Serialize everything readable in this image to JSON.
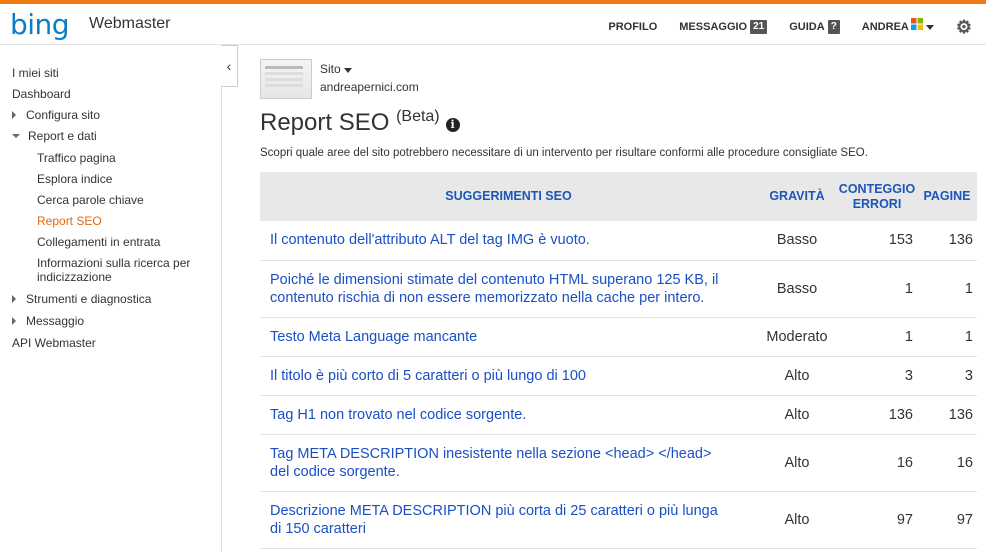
{
  "header": {
    "logo_text": "bing",
    "product": "Webmaster",
    "nav": {
      "profilo": "PROFILO",
      "messaggio": "MESSAGGIO",
      "messaggio_count": "21",
      "guida": "GUIDA",
      "guida_badge": "?",
      "user": "ANDREA"
    }
  },
  "sidebar": {
    "items": [
      {
        "label": "I miei siti"
      },
      {
        "label": "Dashboard"
      },
      {
        "label": "Configura sito"
      },
      {
        "label": "Report e dati"
      },
      {
        "label": "Traffico pagina"
      },
      {
        "label": "Esplora indice"
      },
      {
        "label": "Cerca parole chiave"
      },
      {
        "label": "Report SEO"
      },
      {
        "label": "Collegamenti in entrata"
      },
      {
        "label": "Informazioni sulla ricerca per"
      },
      {
        "label": "indicizzazione"
      },
      {
        "label": "Strumenti e diagnostica"
      },
      {
        "label": "Messaggio"
      },
      {
        "label": "API Webmaster"
      }
    ]
  },
  "main": {
    "site_label": "Sito",
    "site_url": "andreapernici.com",
    "title": "Report SEO",
    "title_badge": "(Beta)",
    "description": "Scopri quale aree del sito potrebbero necessitare di un intervento per risultare conformi alle procedure consigliate SEO.",
    "table": {
      "headers": {
        "suggerimenti": "SUGGERIMENTI SEO",
        "gravita": "GRAVITÀ",
        "conteggio_1": "CONTEGGIO",
        "conteggio_2": "ERRORI",
        "pagine": "PAGINE"
      },
      "rows": [
        {
          "l1": "Il contenuto dell'attributo ALT del tag IMG è vuoto.",
          "l2": "",
          "gravita": "Basso",
          "errori": "153",
          "pagine": "136"
        },
        {
          "l1": "Poiché le dimensioni stimate del contenuto HTML superano 125 KB, il",
          "l2": "contenuto rischia di non essere memorizzato nella cache per intero.",
          "gravita": "Basso",
          "errori": "1",
          "pagine": "1"
        },
        {
          "l1": "Testo Meta Language mancante",
          "l2": "",
          "gravita": "Moderato",
          "errori": "1",
          "pagine": "1"
        },
        {
          "l1": "Il titolo è più corto di 5 caratteri o più lungo di 100",
          "l2": "",
          "gravita": "Alto",
          "errori": "3",
          "pagine": "3"
        },
        {
          "l1": "Tag H1 non trovato nel codice sorgente.",
          "l2": "",
          "gravita": "Alto",
          "errori": "136",
          "pagine": "136"
        },
        {
          "l1": "Tag META DESCRIPTION inesistente nella sezione <head> </head>",
          "l2": "del codice sorgente.",
          "gravita": "Alto",
          "errori": "16",
          "pagine": "16"
        },
        {
          "l1": "Descrizione META DESCRIPTION più corta di 25 caratteri o più lunga",
          "l2": "di 150 caratteri",
          "gravita": "Alto",
          "errori": "97",
          "pagine": "97"
        }
      ]
    }
  },
  "colors": {
    "accent_orange": "#f07a16",
    "link_blue": "#1a4fc6",
    "logo_blue": "#0a7fc4",
    "active_nav": "#e2680f"
  }
}
